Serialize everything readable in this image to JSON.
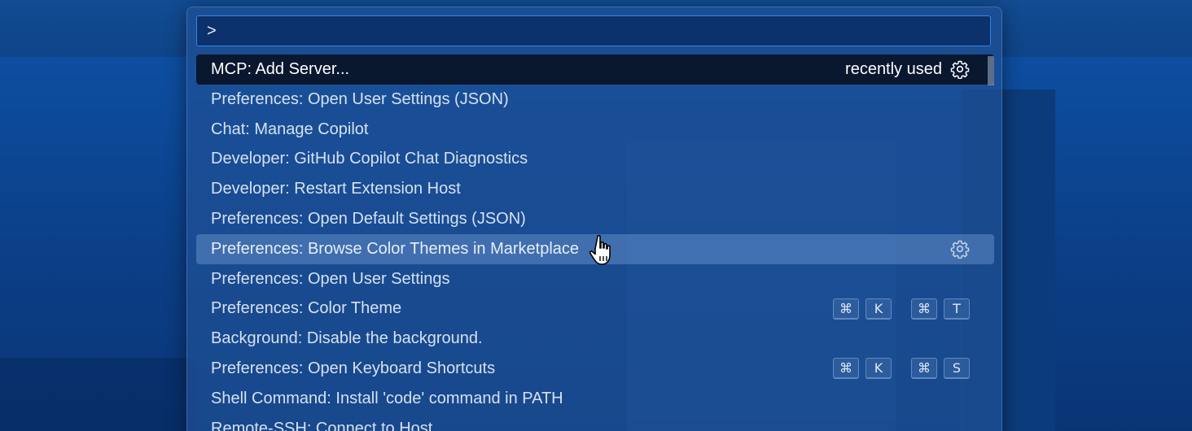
{
  "palette": {
    "query": ">",
    "items": [
      {
        "label": "MCP: Add Server...",
        "detail": "recently used",
        "gear": true,
        "keys": []
      },
      {
        "label": "Preferences: Open User Settings (JSON)",
        "detail": "",
        "gear": false,
        "keys": []
      },
      {
        "label": "Chat: Manage Copilot",
        "detail": "",
        "gear": false,
        "keys": []
      },
      {
        "label": "Developer: GitHub Copilot Chat Diagnostics",
        "detail": "",
        "gear": false,
        "keys": []
      },
      {
        "label": "Developer: Restart Extension Host",
        "detail": "",
        "gear": false,
        "keys": []
      },
      {
        "label": "Preferences: Open Default Settings (JSON)",
        "detail": "",
        "gear": false,
        "keys": []
      },
      {
        "label": "Preferences: Browse Color Themes in Marketplace",
        "detail": "",
        "gear": true,
        "keys": []
      },
      {
        "label": "Preferences: Open User Settings",
        "detail": "",
        "gear": false,
        "keys": []
      },
      {
        "label": "Preferences: Color Theme",
        "detail": "",
        "gear": false,
        "keys": [
          [
            "⌘",
            "K"
          ],
          [
            "⌘",
            "T"
          ]
        ]
      },
      {
        "label": "Background: Disable the background.",
        "detail": "",
        "gear": false,
        "keys": []
      },
      {
        "label": "Preferences: Open Keyboard Shortcuts",
        "detail": "",
        "gear": false,
        "keys": [
          [
            "⌘",
            "K"
          ],
          [
            "⌘",
            "S"
          ]
        ]
      },
      {
        "label": "Shell Command: Install 'code' command in PATH",
        "detail": "",
        "gear": false,
        "keys": []
      },
      {
        "label": "Remote-SSH: Connect to Host...",
        "detail": "",
        "gear": false,
        "keys": []
      }
    ]
  },
  "colors": {
    "accent_border": "#2f86e6",
    "selected_row": "#081226",
    "hover_row": "#6f95c9"
  },
  "icons": {
    "row_action": "gear-icon",
    "pointer": "hand-cursor-icon"
  }
}
